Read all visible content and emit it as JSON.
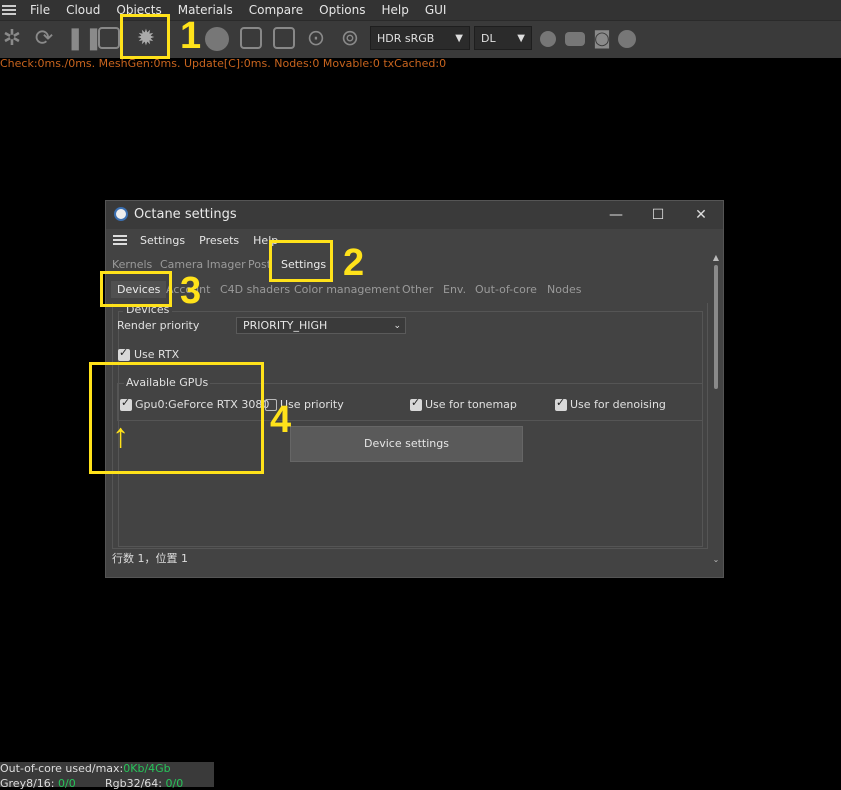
{
  "menubar": {
    "items": [
      "File",
      "Cloud",
      "Objects",
      "Materials",
      "Compare",
      "Options",
      "Help",
      "GUI"
    ]
  },
  "toolbar": {
    "color_select": "HDR sRGB",
    "kernel_select": "DL"
  },
  "status_line": "Check:0ms./0ms. MeshGen:0ms. Update[C]:0ms. Nodes:0 Movable:0 txCached:0",
  "annotations": [
    "1",
    "2",
    "3",
    "4",
    "↑"
  ],
  "dialog": {
    "title": "Octane settings",
    "window_controls": {
      "minimize": "—",
      "maximize": "☐",
      "close": "✕"
    },
    "menu": [
      "Settings",
      "Presets",
      "Help"
    ],
    "tabs_row1": [
      "Kernels",
      "Camera Imager",
      "Post",
      "Settings"
    ],
    "tabs_row2": [
      "Devices",
      "Account",
      "C4D shaders",
      "Color management",
      "Other",
      "Env.",
      "Out-of-core",
      "Nodes"
    ],
    "devices_group_label": "Devices",
    "render_priority_label": "Render priority",
    "render_priority_value": "PRIORITY_HIGH",
    "use_rtx_label": "Use RTX",
    "use_rtx_checked": true,
    "gpus_group_label": "Available GPUs",
    "gpu": {
      "name": "Gpu0:GeForce RTX 3080",
      "enabled": true,
      "use_priority_label": "Use priority",
      "use_priority": false,
      "tonemap_label": "Use for tonemap",
      "tonemap": true,
      "denoising_label": "Use for denoising",
      "denoising": true
    },
    "device_settings_button": "Device settings",
    "status": "行数 1，位置 1"
  },
  "bottom_stats": {
    "ooc_label": "Out-of-core used/max:",
    "ooc_value": "0Kb/4Gb",
    "grey_label": "Grey8/16: ",
    "grey_value": "0/0",
    "rgb_label": "Rgb32/64: ",
    "rgb_value": "0/0"
  },
  "colors": {
    "annotation": "#ffe21a",
    "status_text": "#c8641e",
    "stat_value": "#27c45a"
  }
}
